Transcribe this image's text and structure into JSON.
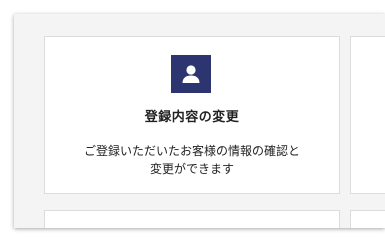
{
  "card": {
    "icon": "user-icon",
    "title": "登録内容の変更",
    "description_line1": "ご登録いただいたお客様の情報の確認と",
    "description_line2": "変更ができます"
  },
  "colors": {
    "icon_background": "#2c3570",
    "panel_background": "#f4f4f4",
    "card_border": "#dcdcdc"
  }
}
